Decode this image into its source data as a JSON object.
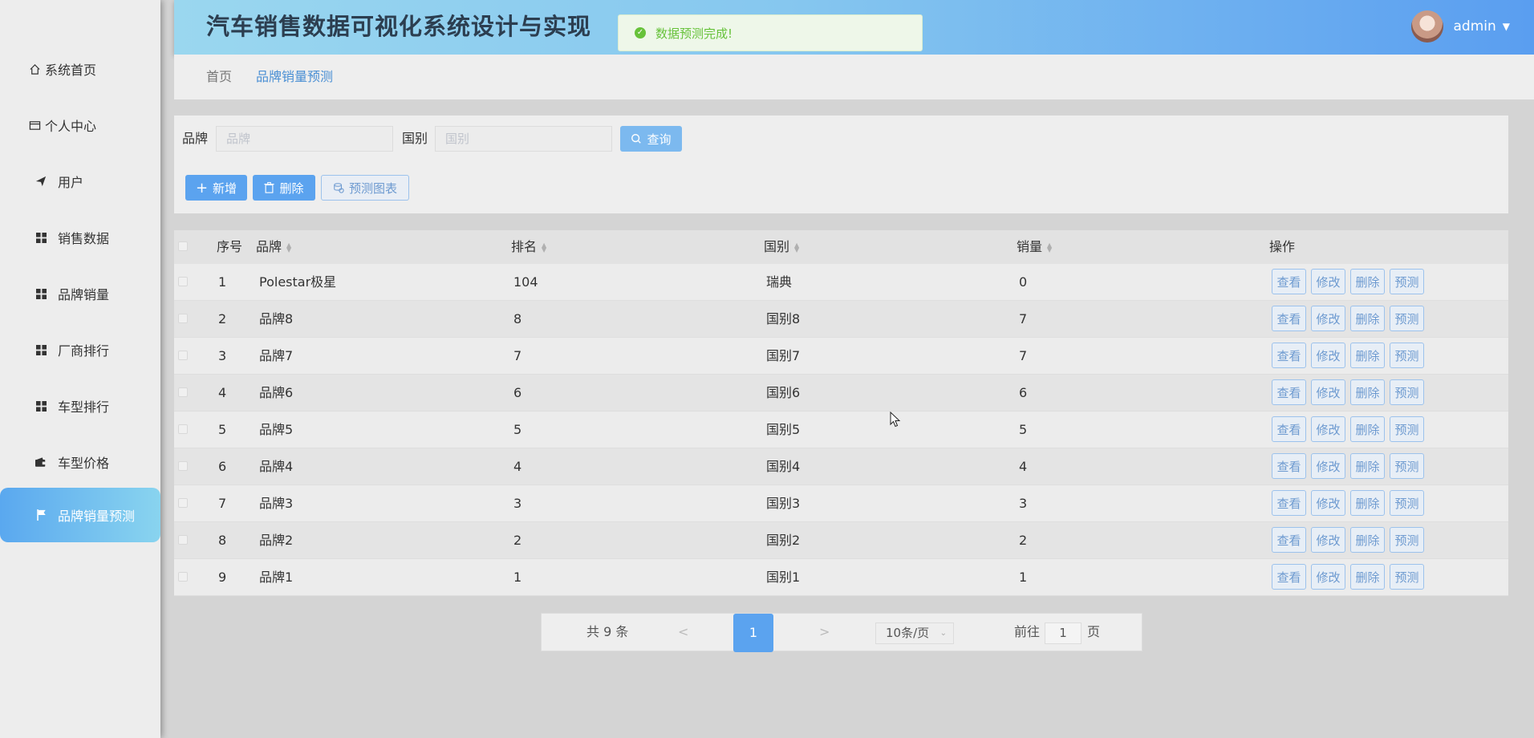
{
  "header": {
    "title": "汽车销售数据可视化系统设计与实现",
    "toast": "数据预测完成!",
    "username": "admin",
    "caret": "▼"
  },
  "sidebar": {
    "items": [
      {
        "label": "系统首页",
        "icon": "home-icon"
      },
      {
        "label": "个人中心",
        "icon": "id-card-icon"
      },
      {
        "label": "用户",
        "icon": "paper-plane-icon"
      },
      {
        "label": "销售数据",
        "icon": "grid-icon"
      },
      {
        "label": "品牌销量",
        "icon": "grid-icon"
      },
      {
        "label": "厂商排行",
        "icon": "grid-icon"
      },
      {
        "label": "车型排行",
        "icon": "grid-icon"
      },
      {
        "label": "车型价格",
        "icon": "wallet-icon"
      },
      {
        "label": "品牌销量预测",
        "icon": "flag-icon",
        "active": true
      }
    ]
  },
  "breadcrumb": {
    "home": "首页",
    "current": "品牌销量预测"
  },
  "search": {
    "brand_label": "品牌",
    "brand_placeholder": "品牌",
    "country_label": "国别",
    "country_placeholder": "国别",
    "query_button": "查询"
  },
  "toolbar": {
    "add": "新增",
    "delete": "删除",
    "chart": "预测图表"
  },
  "table": {
    "columns": [
      "序号",
      "品牌",
      "排名",
      "国别",
      "销量",
      "操作"
    ],
    "rows": [
      [
        "1",
        "Polestar极星",
        "104",
        "瑞典",
        "0"
      ],
      [
        "2",
        "品牌8",
        "8",
        "国别8",
        "7"
      ],
      [
        "3",
        "品牌7",
        "7",
        "国别7",
        "7"
      ],
      [
        "4",
        "品牌6",
        "6",
        "国别6",
        "6"
      ],
      [
        "5",
        "品牌5",
        "5",
        "国别5",
        "5"
      ],
      [
        "6",
        "品牌4",
        "4",
        "国别4",
        "4"
      ],
      [
        "7",
        "品牌3",
        "3",
        "国别3",
        "3"
      ],
      [
        "8",
        "品牌2",
        "2",
        "国别2",
        "2"
      ],
      [
        "9",
        "品牌1",
        "1",
        "国别1",
        "1"
      ]
    ],
    "actions": [
      "查看",
      "修改",
      "删除",
      "预测"
    ]
  },
  "pagination": {
    "total": "共 9 条",
    "prev": "<",
    "current": "1",
    "next": ">",
    "page_size": "10条/页",
    "goto_label": "前往",
    "goto_value": "1",
    "page_suffix": "页"
  }
}
